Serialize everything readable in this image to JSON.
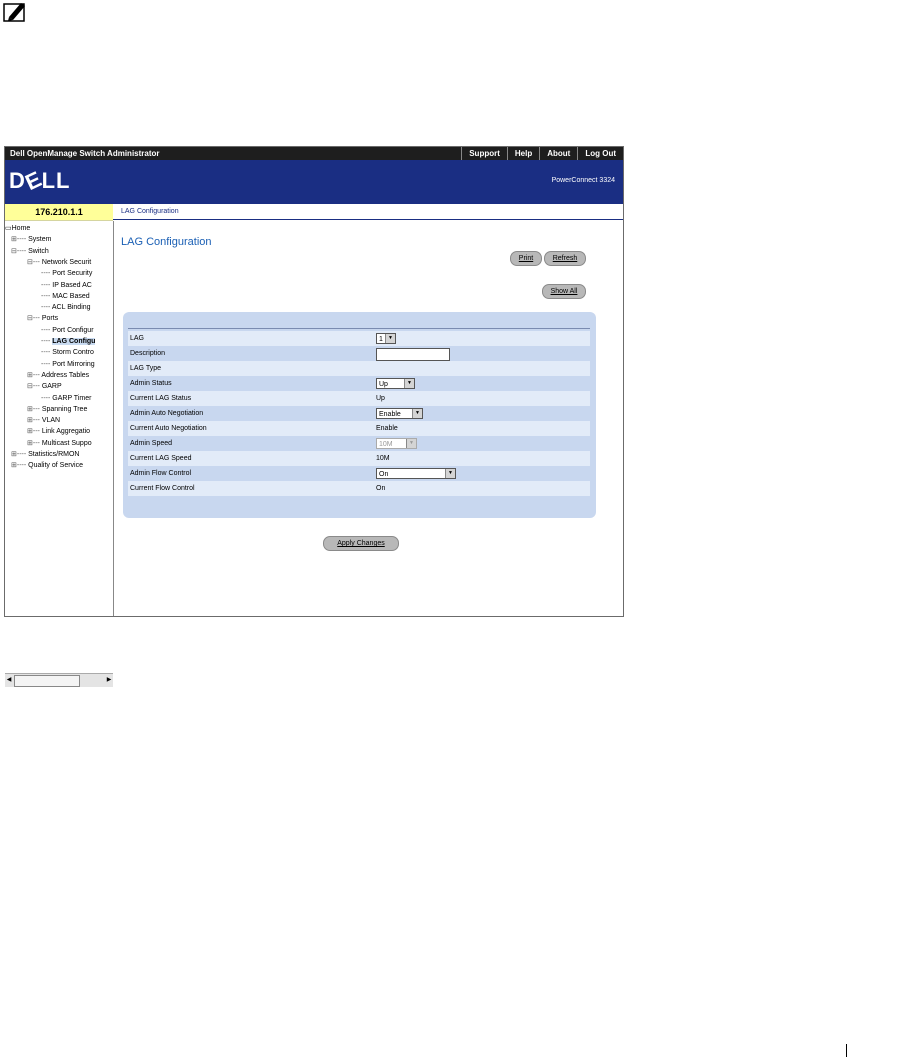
{
  "window": {
    "title": "Dell OpenManage Switch Administrator",
    "menu": [
      "Support",
      "Help",
      "About",
      "Log Out"
    ]
  },
  "banner": {
    "logo": "DELL",
    "model": "PowerConnect 3324"
  },
  "ip": "176.210.1.1",
  "breadcrumb": "LAG Configuration",
  "tree": [
    {
      "label": "Home",
      "prefix": ""
    },
    {
      "label": "System",
      "prefix": "⊞---- "
    },
    {
      "label": "Switch",
      "prefix": "⊟---- "
    },
    {
      "label": "Network Securit",
      "prefix": "⊟--- "
    },
    {
      "label": "Port Security",
      "prefix": "---- "
    },
    {
      "label": "IP Based AC",
      "prefix": "---- "
    },
    {
      "label": "MAC Based",
      "prefix": "---- "
    },
    {
      "label": "ACL Binding",
      "prefix": "---- "
    },
    {
      "label": "Ports",
      "prefix": "⊟--- "
    },
    {
      "label": "Port Configur",
      "prefix": "---- "
    },
    {
      "label": "LAG Configu",
      "prefix": "---- "
    },
    {
      "label": "Storm Contro",
      "prefix": "---- "
    },
    {
      "label": "Port Mirroring",
      "prefix": "---- "
    },
    {
      "label": "Address Tables",
      "prefix": "⊞--- "
    },
    {
      "label": "GARP",
      "prefix": "⊟--- "
    },
    {
      "label": "GARP Timer",
      "prefix": "---- "
    },
    {
      "label": "Spanning Tree",
      "prefix": "⊞--- "
    },
    {
      "label": "VLAN",
      "prefix": "⊞--- "
    },
    {
      "label": "Link Aggregatio",
      "prefix": "⊞--- "
    },
    {
      "label": "Multicast Suppo",
      "prefix": "⊞--- "
    },
    {
      "label": "Statistics/RMON",
      "prefix": "⊞---- "
    },
    {
      "label": "Quality of Service",
      "prefix": "⊞---- "
    }
  ],
  "page": {
    "title": "LAG Configuration",
    "print_label": "Print",
    "refresh_label": "Refresh",
    "show_all_label": "Show All",
    "apply_label": "Apply Changes"
  },
  "form": {
    "lag_label": "LAG",
    "lag_value": "1",
    "description_label": "Description",
    "description_value": "",
    "lag_type_label": "LAG Type",
    "lag_type_value": "",
    "admin_status_label": "Admin Status",
    "admin_status_value": "Up",
    "current_status_label": "Current LAG Status",
    "current_status_value": "Up",
    "admin_auto_neg_label": "Admin Auto Negotiation",
    "admin_auto_neg_value": "Enable",
    "current_auto_neg_label": "Current Auto Negotiation",
    "current_auto_neg_value": "Enable",
    "admin_speed_label": "Admin Speed",
    "admin_speed_value": "10M",
    "current_speed_label": "Current LAG Speed",
    "current_speed_value": "10M",
    "admin_flow_label": "Admin Flow Control",
    "admin_flow_value": "On",
    "current_flow_label": "Current Flow Control",
    "current_flow_value": "On"
  }
}
